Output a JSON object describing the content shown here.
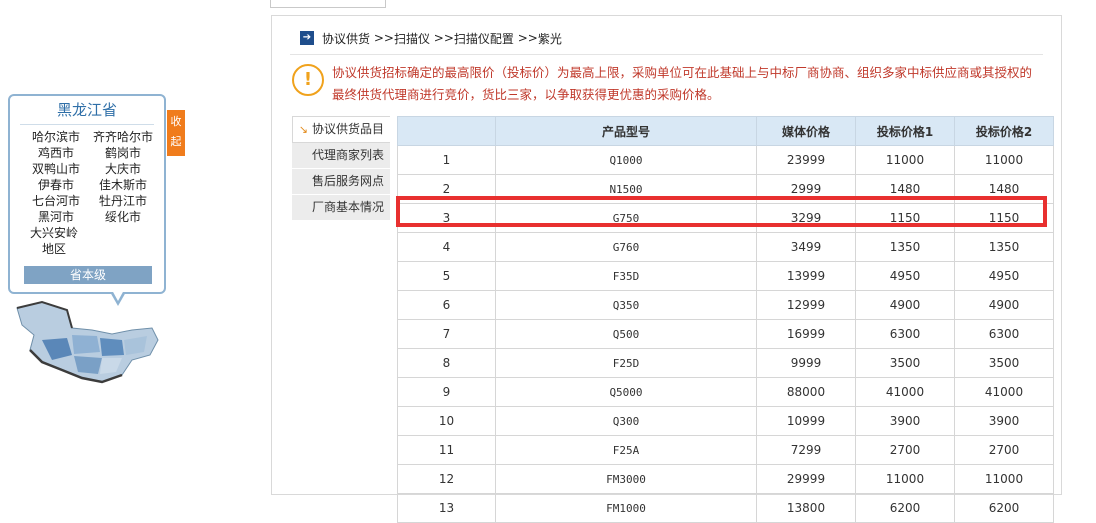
{
  "province": {
    "name": "黑龙江省",
    "cities": [
      "哈尔滨市",
      "齐齐哈尔市",
      "鸡西市",
      "鹤岗市",
      "双鸭山市",
      "大庆市",
      "伊春市",
      "佳木斯市",
      "七台河市",
      "牡丹江市",
      "黑河市",
      "绥化市",
      "大兴安岭地区"
    ],
    "level_button": "省本级",
    "collapse_label": "收起"
  },
  "breadcrumb": {
    "root": "协议供货",
    "sep": " >>",
    "level2": "扫描仪",
    "level3": "扫描仪配置",
    "level4": "紫光"
  },
  "notice": "协议供货招标确定的最高限价（投标价）为最高上限，采购单位可在此基础上与中标厂商协商、组织多家中标供应商或其授权的最终供货代理商进行竞价，货比三家，以争取获得更优惠的采购价格。",
  "side_tabs": [
    "协议供货品目",
    "代理商家列表",
    "售后服务网点",
    "厂商基本情况"
  ],
  "table": {
    "headers": [
      "",
      "产品型号",
      "媒体价格",
      "投标价格1",
      "投标价格2"
    ],
    "rows": [
      [
        "1",
        "Q1000",
        "23999",
        "11000",
        "11000"
      ],
      [
        "2",
        "N1500",
        "2999",
        "1480",
        "1480"
      ],
      [
        "3",
        "G750",
        "3299",
        "1150",
        "1150"
      ],
      [
        "4",
        "G760",
        "3499",
        "1350",
        "1350"
      ],
      [
        "5",
        "F35D",
        "13999",
        "4950",
        "4950"
      ],
      [
        "6",
        "Q350",
        "12999",
        "4900",
        "4900"
      ],
      [
        "7",
        "Q500",
        "16999",
        "6300",
        "6300"
      ],
      [
        "8",
        "F25D",
        "9999",
        "3500",
        "3500"
      ],
      [
        "9",
        "Q5000",
        "88000",
        "41000",
        "41000"
      ],
      [
        "10",
        "Q300",
        "10999",
        "3900",
        "3900"
      ],
      [
        "11",
        "F25A",
        "7299",
        "2700",
        "2700"
      ],
      [
        "12",
        "FM3000",
        "29999",
        "11000",
        "11000"
      ],
      [
        "13",
        "FM1000",
        "13800",
        "6200",
        "6200"
      ]
    ]
  },
  "colors": {
    "highlight": "#e8302f",
    "notice": "#c0392b",
    "header_bg": "#d9e8f5",
    "tab_accent": "#f07c1c"
  }
}
